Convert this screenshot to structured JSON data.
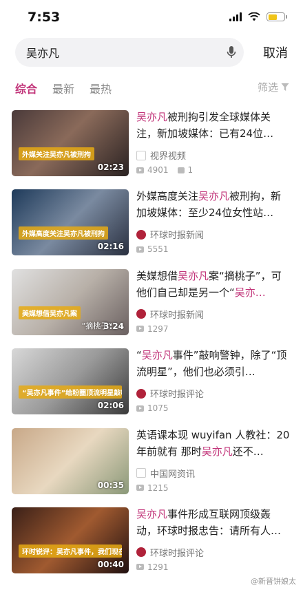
{
  "status_bar": {
    "time": "7:53",
    "battery_color": "#f0c419"
  },
  "search": {
    "query": "吴亦凡",
    "cancel_label": "取消",
    "mic_icon": "mic-icon"
  },
  "tabs": [
    {
      "label": "综合",
      "active": true
    },
    {
      "label": "最新",
      "active": false
    },
    {
      "label": "最热",
      "active": false
    }
  ],
  "filter_label": "筛选",
  "accent_color": "#c2357a",
  "results": [
    {
      "title_parts": [
        [
          "吴亦凡",
          true
        ],
        [
          "被刑拘引发全球媒体关注，新加坡媒体：已有24位…",
          false
        ]
      ],
      "source": "视界视频",
      "views": "4901",
      "comments": "1",
      "duration": "02:23",
      "caption": "外媒关注吴亦凡被刑拘",
      "badge": "",
      "thumb_bg": "linear-gradient(135deg,#4a3a3a,#8a6a5a 45%,#2a2222)"
    },
    {
      "title_parts": [
        [
          "外媒高度关注",
          false
        ],
        [
          "吴亦凡",
          true
        ],
        [
          "被刑拘，新加坡媒体：至少24位女性站…",
          false
        ]
      ],
      "source": "环球时报新闻",
      "views": "5551",
      "comments": "",
      "duration": "02:16",
      "caption": "外媒高度关注吴亦凡被刑拘",
      "badge": "",
      "thumb_bg": "linear-gradient(135deg,#1e3a5a,#7a8aa0 50%,#2a3040)"
    },
    {
      "title_parts": [
        [
          "美媒想借",
          false
        ],
        [
          "吴亦凡",
          true
        ],
        [
          "案“摘桃子”，可他们自己却是另一个“",
          false
        ],
        [
          "吴亦…",
          true
        ]
      ],
      "source": "环球时报新闻",
      "views": "1297",
      "comments": "",
      "duration": "3:24",
      "caption": "美媒想借吴亦凡案",
      "badge": "“摘桃子”",
      "thumb_bg": "linear-gradient(135deg,#e0e0e0,#b8b0a8 50%,#6a6060)"
    },
    {
      "title_parts": [
        [
          "“",
          false
        ],
        [
          "吴亦凡",
          true
        ],
        [
          "事件”敲响警钟，除了“顶流明星”，他们也必须引…",
          false
        ]
      ],
      "source": "环球时报评论",
      "views": "1075",
      "comments": "",
      "duration": "02:06",
      "caption": "“吴亦凡事件”给粉圈顶流明星敲响警钟",
      "badge": "",
      "thumb_bg": "linear-gradient(135deg,#d8d8d8,#9a9a9a 50%,#3a3a3a)"
    },
    {
      "title_parts": [
        [
          "英语课本现 wuyifan 人教社：20年前就有 那时",
          false
        ],
        [
          "吴亦凡",
          true
        ],
        [
          "还不…",
          false
        ]
      ],
      "source": "中国网资讯",
      "views": "1215",
      "comments": "",
      "duration": "00:35",
      "caption": "",
      "badge": "",
      "thumb_bg": "linear-gradient(135deg,#c8a888,#e8d8c0 50%,#8a9878)"
    },
    {
      "title_parts": [
        [
          "吴亦凡",
          true
        ],
        [
          "事件形成互联网顶级轰动，环球时报忠告：请所有人…",
          false
        ]
      ],
      "source": "环球时报评论",
      "views": "1291",
      "comments": "",
      "duration": "00:40",
      "caption": "环时锐评：吴亦凡事件，我们现在需要说的是",
      "badge": "",
      "thumb_bg": "linear-gradient(135deg,#3a2018,#a05a30 50%,#201010)"
    }
  ],
  "watermark": "@新晋饼娘太"
}
